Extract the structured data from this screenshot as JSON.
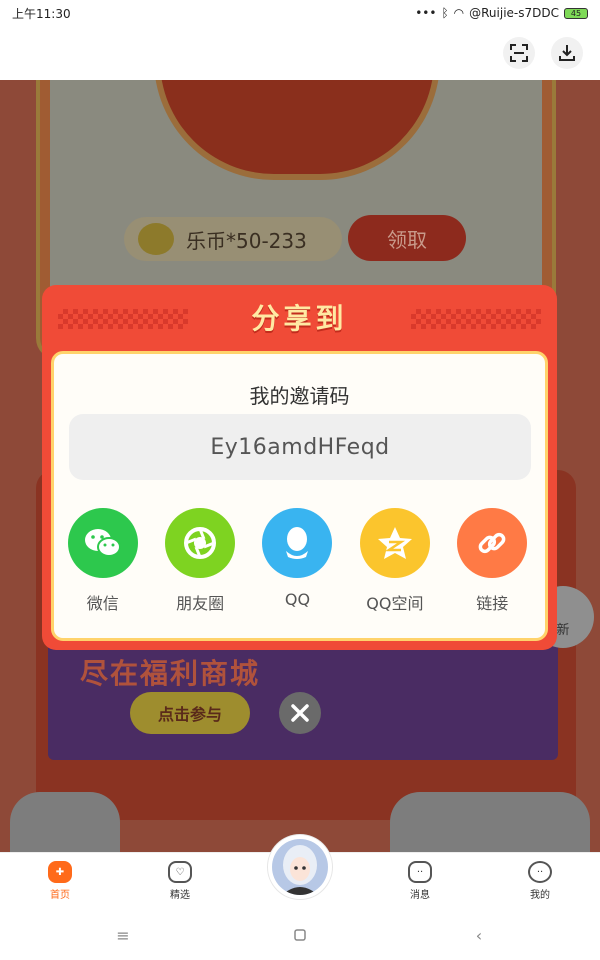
{
  "status_bar": {
    "time": "上午11:30",
    "network": "@Ruijie-s7DDC",
    "battery": "45"
  },
  "toolbar": {
    "scan_icon": "scan-icon",
    "download_icon": "download-icon"
  },
  "background": {
    "coins_label": "乐币*50-233",
    "claim_label": "领取",
    "banner_title": "尽在福利商城",
    "banner_button": "点击参与",
    "refresh_label": "新"
  },
  "share_dialog": {
    "title": "分享到",
    "invite_label": "我的邀请码",
    "invite_code": "Ey16amdHFeqd",
    "targets": [
      {
        "label": "微信",
        "icon": "wechat-icon",
        "color": "#2dc84d"
      },
      {
        "label": "朋友圈",
        "icon": "moments-icon",
        "color": "#7ed321"
      },
      {
        "label": "QQ",
        "icon": "qq-icon",
        "color": "#39b4f0"
      },
      {
        "label": "QQ空间",
        "icon": "qzone-icon",
        "color": "#fbc52d"
      },
      {
        "label": "链接",
        "icon": "link-icon",
        "color": "#ff7a45"
      }
    ]
  },
  "bottom_nav": {
    "items": [
      {
        "label": "首页",
        "icon": "gamepad-icon",
        "active": true
      },
      {
        "label": "精选",
        "icon": "heart-icon",
        "active": false
      },
      {
        "label": "消息",
        "icon": "message-icon",
        "active": false
      },
      {
        "label": "我的",
        "icon": "profile-icon",
        "active": false
      }
    ]
  },
  "colors": {
    "accent": "#ff6a1a",
    "dialog_red": "#f04b37",
    "title_gold": "#ffe9a3"
  }
}
